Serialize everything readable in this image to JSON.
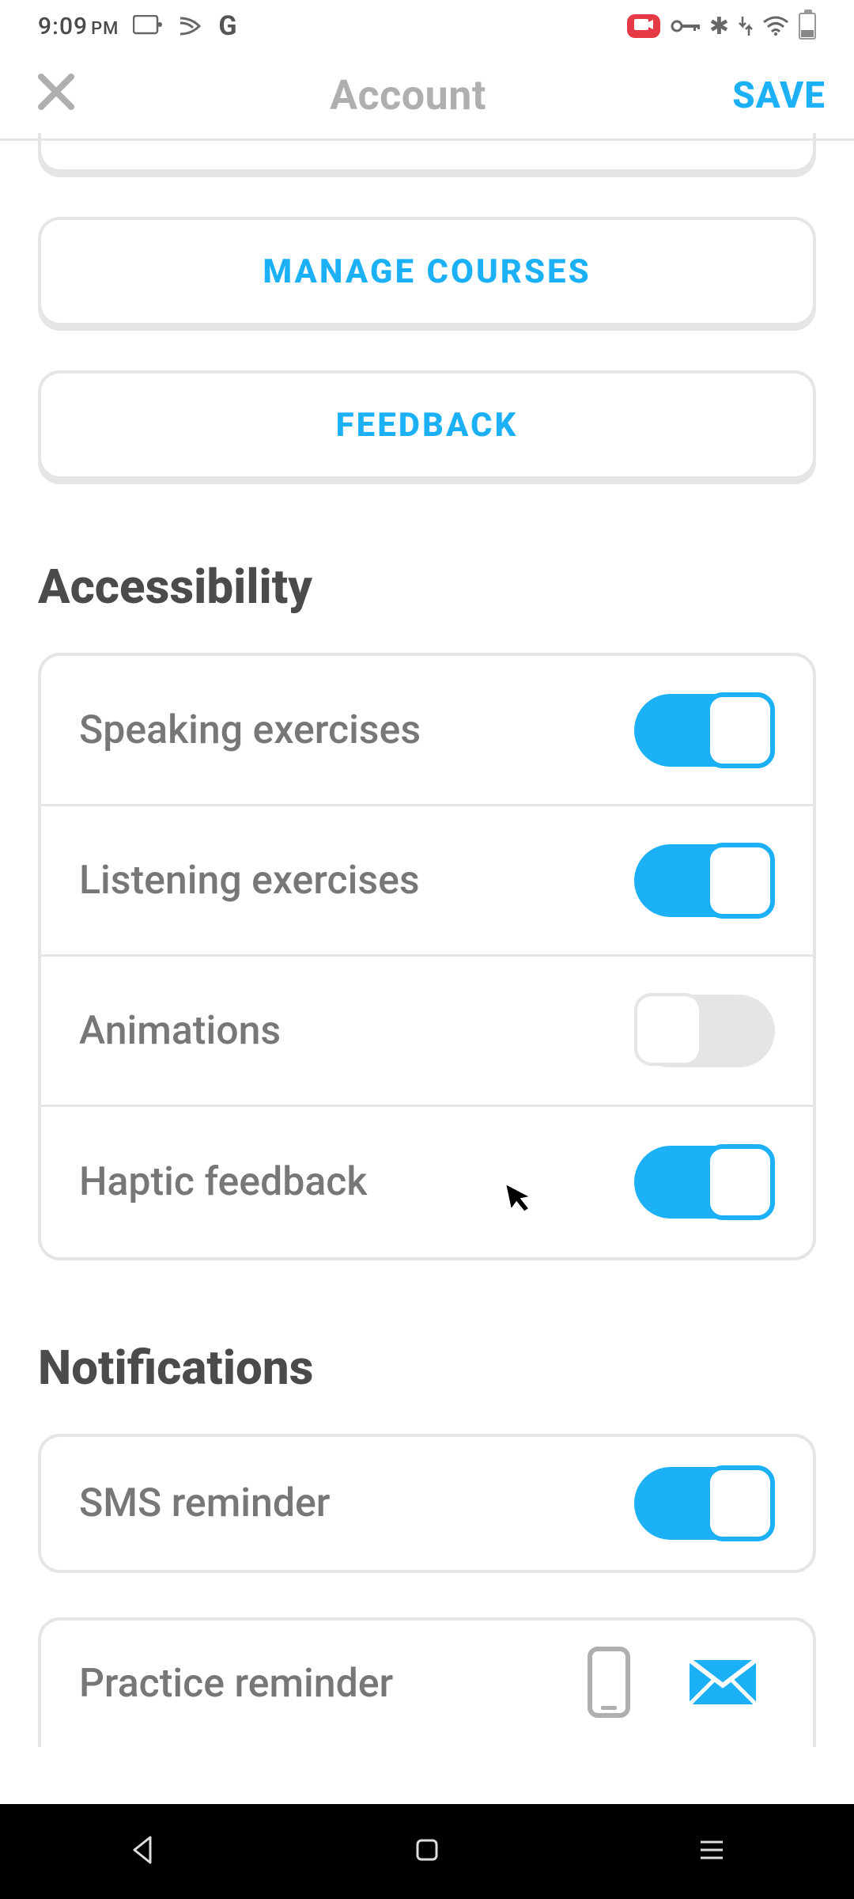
{
  "status": {
    "time": "9:09",
    "ampm": "PM"
  },
  "header": {
    "title": "Account",
    "save": "SAVE"
  },
  "buttons": {
    "manage_courses": "MANAGE COURSES",
    "feedback": "FEEDBACK"
  },
  "sections": {
    "accessibility": "Accessibility",
    "notifications": "Notifications"
  },
  "accessibility": {
    "speaking": {
      "label": "Speaking exercises",
      "on": true
    },
    "listening": {
      "label": "Listening exercises",
      "on": true
    },
    "animations": {
      "label": "Animations",
      "on": false
    },
    "haptic": {
      "label": "Haptic feedback",
      "on": true
    }
  },
  "notifications": {
    "sms": {
      "label": "SMS reminder",
      "on": true
    },
    "practice": {
      "label": "Practice reminder"
    }
  }
}
